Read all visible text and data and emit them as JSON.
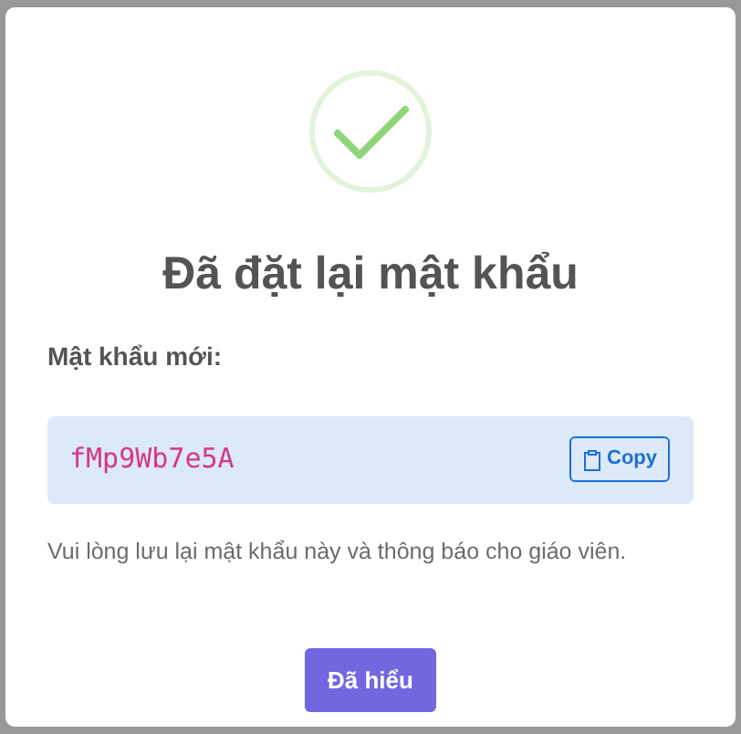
{
  "dialog": {
    "title": "Đã đặt lại mật khẩu",
    "password_label": "Mật khẩu mới:",
    "password": "fMp9Wb7e5A",
    "copy_button": "Copy",
    "note": "Vui lòng lưu lại mật khẩu này và thông báo cho giáo viên.",
    "confirm_button": "Đã hiểu"
  }
}
